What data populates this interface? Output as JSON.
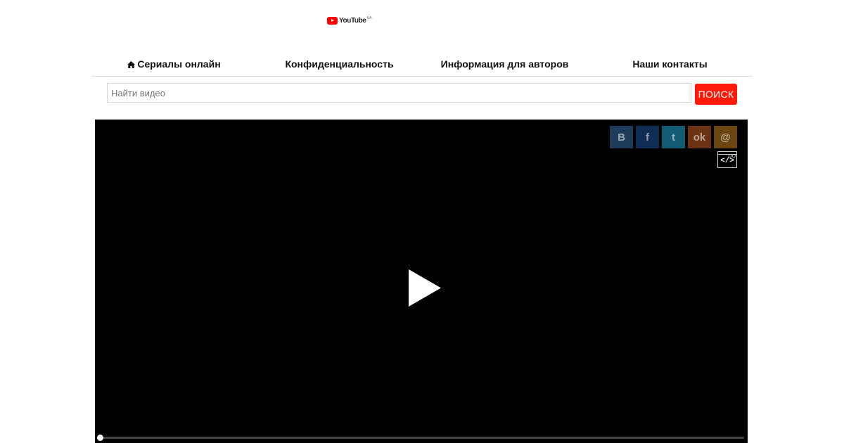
{
  "logo": {
    "text": "YouTube",
    "region": "UA",
    "icon": "youtube-play-icon",
    "color": "#ff0000"
  },
  "nav": {
    "items": [
      {
        "label": "Сериалы онлайн",
        "icon": "home-icon"
      },
      {
        "label": "Конфиденциальность"
      },
      {
        "label": "Информация для авторов"
      },
      {
        "label": "Наши контакты"
      }
    ]
  },
  "search": {
    "placeholder": "Найти видео",
    "value": "",
    "button_label": "ПОИСК",
    "button_color": "#ff1a0a"
  },
  "player": {
    "share_buttons": [
      {
        "label": "В",
        "icon": "vk-icon",
        "color": "#1f3b5a"
      },
      {
        "label": "f",
        "icon": "facebook-icon",
        "color": "#0f2d52"
      },
      {
        "label": "t",
        "icon": "twitter-icon",
        "color": "#135b72"
      },
      {
        "label": "ok",
        "icon": "odnoklassniki-icon",
        "color": "#6b3214"
      },
      {
        "label": "@",
        "icon": "mail-icon",
        "color": "#6b4510"
      }
    ],
    "embed": {
      "label": "</>",
      "tag": "DO",
      "icon": "embed-code-icon"
    },
    "play_icon": "play-icon",
    "progress": 0
  }
}
